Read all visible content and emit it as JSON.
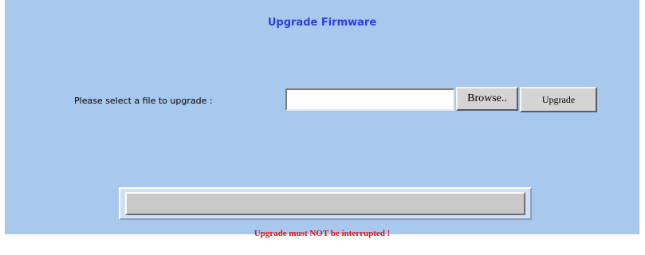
{
  "page": {
    "title": "Upgrade Firmware"
  },
  "upload": {
    "label": "Please select a file to upgrade :",
    "file_value": "",
    "browse_label": "Browse..",
    "upgrade_label": "Upgrade"
  },
  "progress": {
    "value_percent": 0
  },
  "warning": {
    "text": "Upgrade must NOT be interrupted !"
  },
  "colors": {
    "panel_background": "#a8c8ee",
    "title": "#2a3fe0",
    "warning": "#e01010",
    "button_face": "#d4d4d4"
  }
}
